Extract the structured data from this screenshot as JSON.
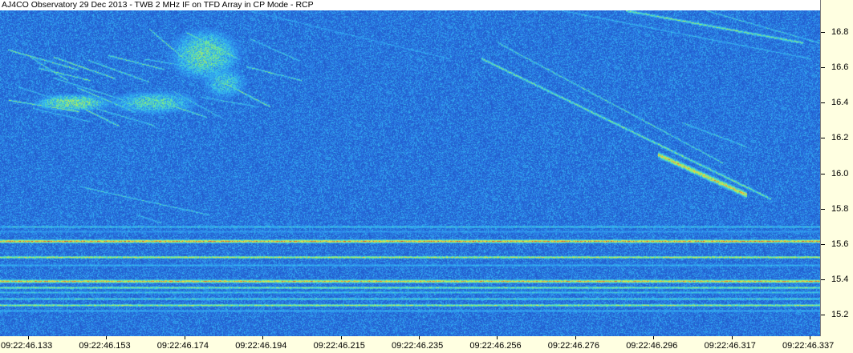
{
  "window": {
    "title": "AJ4CO Observatory 29 Dec 2013 - TWB 2 MHz IF on TFD Array in CP Mode - RCP"
  },
  "chart_data": {
    "type": "heatmap",
    "title": "AJ4CO Observatory 29 Dec 2013 - TWB 2 MHz IF on TFD Array in CP Mode - RCP",
    "y_axis": {
      "ticks": [
        "16.8",
        "16.6",
        "16.4",
        "16.2",
        "16.0",
        "15.8",
        "15.6",
        "15.4",
        "15.2"
      ],
      "range": [
        15.08,
        16.92
      ]
    },
    "x_axis": {
      "ticks": [
        "09:22:46.133",
        "09:22:46.153",
        "09:22:46.174",
        "09:22:46.194",
        "09:22:46.215",
        "09:22:46.235",
        "09:22:46.256",
        "09:22:46.276",
        "09:22:46.296",
        "09:22:46.317",
        "09:22:46.337"
      ]
    },
    "colormap": [
      "#1a3fb0",
      "#2b7be8",
      "#35c3f0",
      "#7ff07f",
      "#f0e040",
      "#f07830",
      "#d02020"
    ],
    "background_color": "#1a3fb0"
  }
}
